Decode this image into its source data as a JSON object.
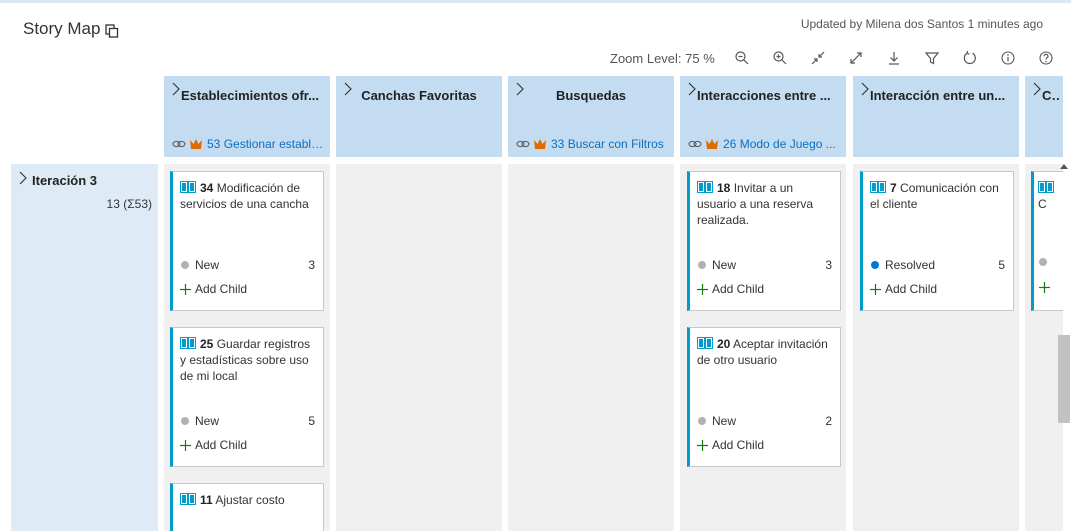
{
  "header": {
    "title": "Story Map",
    "updated": "Updated by Milena dos Santos 1 minutes ago"
  },
  "toolbar": {
    "zoom_label": "Zoom Level: 75 %"
  },
  "columns": [
    {
      "title": "Establecimientos ofr...",
      "epic_number": "53",
      "epic_title": "Gestionar estable..."
    },
    {
      "title": "Canchas Favoritas"
    },
    {
      "title": "Busquedas",
      "epic_number": "33",
      "epic_title": "Buscar con Filtros"
    },
    {
      "title": "Interacciones entre ...",
      "epic_number": "26",
      "epic_title": "Modo de Juego ..."
    },
    {
      "title": "Interacción entre un..."
    },
    {
      "title": "Cor"
    }
  ],
  "iteration": {
    "title": "Iteración 3",
    "count": "13 (Σ53)"
  },
  "cards": [
    {
      "id": "34",
      "title": "Modificación de servicios de una cancha",
      "state": "New",
      "effort": "3",
      "add_child": "Add Child"
    },
    {
      "id": "25",
      "title": "Guardar registros y estadísticas sobre uso de mi local",
      "state": "New",
      "effort": "5",
      "add_child": "Add Child"
    },
    {
      "id": "11",
      "title": "Ajustar costo"
    },
    {
      "id": "18",
      "title": "Invitar a un usuario a una reserva realizada.",
      "state": "New",
      "effort": "3",
      "add_child": "Add Child"
    },
    {
      "id": "20",
      "title": "Aceptar invitación de otro usuario",
      "state": "New",
      "effort": "2",
      "add_child": "Add Child"
    },
    {
      "id": "7",
      "title": "Comunicación con el cliente",
      "state": "Resolved",
      "effort": "5",
      "add_child": "Add Child"
    },
    {
      "title": "C"
    }
  ],
  "colors": {
    "header_bg": "#c3dcf1",
    "card_accent": "#009ccc",
    "state_new": "#b2b2b2",
    "state_resolved": "#0078d4",
    "epic_crown": "#e06c00"
  }
}
